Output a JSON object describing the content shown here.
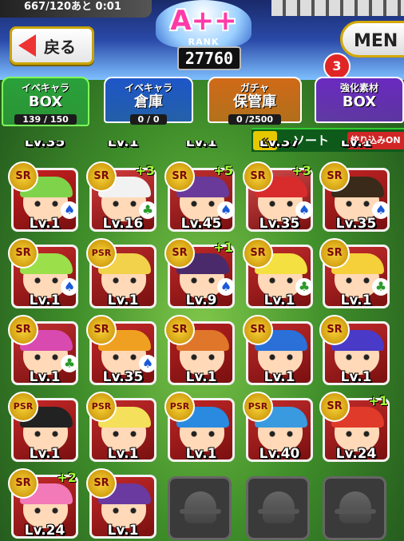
{
  "header": {
    "status_text": "667/120あと 0:01",
    "back_label": "戻る",
    "rank": {
      "grade": "A++",
      "label": "RANK",
      "score": "27760"
    },
    "menu_label": "MEN",
    "notification_count": "3"
  },
  "tabs": [
    {
      "line1": "イベキャラ",
      "line2": "BOX",
      "count": "139 / 150",
      "color": "#2aa03a",
      "active": true
    },
    {
      "line1": "イベキャラ",
      "line2": "倉庫",
      "count": "0 / 0",
      "color": "#1e56c8",
      "active": false
    },
    {
      "line1": "ガチャ",
      "line2": "保管庫",
      "count": "0 /2500",
      "color": "#d06a18",
      "active": false
    },
    {
      "line1": "強化素材",
      "line2": "BOX",
      "count": "",
      "color": "#6a2ac0",
      "active": false
    }
  ],
  "sort": {
    "label": "ソート",
    "filter_label": "絞り込みON"
  },
  "partial_row_levels": [
    "Lv.35",
    "Lv.1",
    "Lv.1",
    "Lv.37",
    "Lv.1"
  ],
  "cards": [
    {
      "rarity": "SR",
      "plus": "",
      "level": "Lv.1",
      "suit": "♠",
      "hair": "#7fd34a",
      "bg": "#c92020"
    },
    {
      "rarity": "SR",
      "plus": "+3",
      "level": "Lv.16",
      "suit": "♣",
      "hair": "#f2f2f2",
      "bg": "#d43c3c"
    },
    {
      "rarity": "SR",
      "plus": "+5",
      "level": "Lv.45",
      "suit": "♠",
      "hair": "#6a3a9a",
      "bg": "#c03030"
    },
    {
      "rarity": "SR",
      "plus": "+3",
      "level": "Lv.35",
      "suit": "♠",
      "hair": "#d82c2c",
      "bg": "#d14a4a"
    },
    {
      "rarity": "SR",
      "plus": "",
      "level": "Lv.35",
      "suit": "♠",
      "hair": "#3a2a1a",
      "bg": "#c22424"
    },
    {
      "rarity": "SR",
      "plus": "",
      "level": "Lv.1",
      "suit": "♠",
      "hair": "#9be04a",
      "bg": "#c62a2a"
    },
    {
      "rarity": "PSR",
      "plus": "",
      "level": "Lv.1",
      "suit": "",
      "hair": "#f2d24a",
      "bg": "#b82a2a"
    },
    {
      "rarity": "SR",
      "plus": "+1",
      "level": "Lv.9",
      "suit": "♠",
      "hair": "#4a2a6a",
      "bg": "#c12828"
    },
    {
      "rarity": "SR",
      "plus": "",
      "level": "Lv.1",
      "suit": "♣",
      "hair": "#f4e040",
      "bg": "#c42b2b"
    },
    {
      "rarity": "SR",
      "plus": "",
      "level": "Lv.1",
      "suit": "♣",
      "hair": "#f5d03a",
      "bg": "#c72d2d"
    },
    {
      "rarity": "SR",
      "plus": "",
      "level": "Lv.1",
      "suit": "♣",
      "hair": "#d84ab0",
      "bg": "#c23030"
    },
    {
      "rarity": "SR",
      "plus": "",
      "level": "Lv.35",
      "suit": "♠",
      "hair": "#f0a020",
      "bg": "#c52929"
    },
    {
      "rarity": "SR",
      "plus": "",
      "level": "Lv.1",
      "suit": "",
      "hair": "#e0762a",
      "bg": "#b52020"
    },
    {
      "rarity": "SR",
      "plus": "",
      "level": "Lv.1",
      "suit": "",
      "hair": "#2a70d8",
      "bg": "#c02a2a"
    },
    {
      "rarity": "SR",
      "plus": "",
      "level": "Lv.1",
      "suit": "",
      "hair": "#4a3ac8",
      "bg": "#c22b2b"
    },
    {
      "rarity": "PSR",
      "plus": "",
      "level": "Lv.1",
      "suit": "",
      "hair": "#222222",
      "bg": "#c72828"
    },
    {
      "rarity": "PSR",
      "plus": "",
      "level": "Lv.1",
      "suit": "",
      "hair": "#f4e05a",
      "bg": "#c32a2a"
    },
    {
      "rarity": "PSR",
      "plus": "",
      "level": "Lv.1",
      "suit": "",
      "hair": "#2a8ae0",
      "bg": "#c12626"
    },
    {
      "rarity": "PSR",
      "plus": "",
      "level": "Lv.40",
      "suit": "",
      "hair": "#3a9ae0",
      "bg": "#c22a2a"
    },
    {
      "rarity": "SR",
      "plus": "+1",
      "level": "Lv.24",
      "suit": "",
      "hair": "#e03a2a",
      "bg": "#c12a2a"
    },
    {
      "rarity": "SR",
      "plus": "+2",
      "level": "Lv.24",
      "suit": "",
      "hair": "#f27ab8",
      "bg": "#c52a2a"
    },
    {
      "rarity": "SR",
      "plus": "",
      "level": "Lv.1",
      "suit": "",
      "hair": "#6a3aa0",
      "bg": "#c42828"
    }
  ],
  "empty_slots": 3
}
